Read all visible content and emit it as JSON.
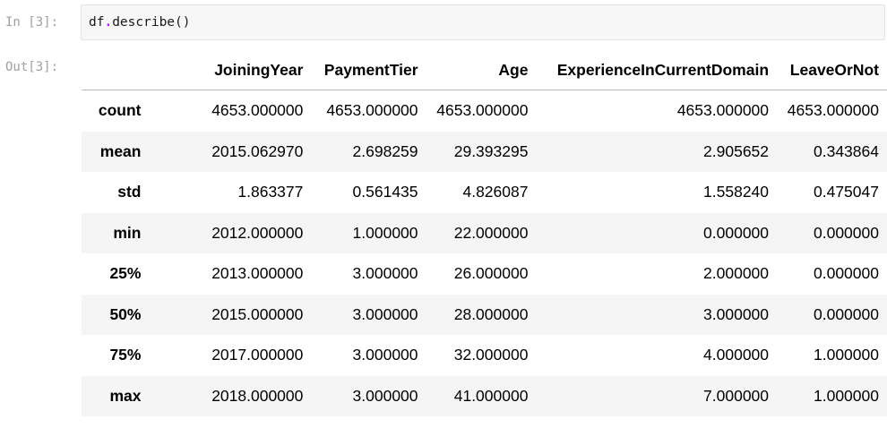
{
  "cell_in": {
    "prompt": "In [3]:",
    "code_obj": "df",
    "code_dot": ".",
    "code_method": "describe",
    "code_parens": "()"
  },
  "cell_out": {
    "prompt": "Out[3]:"
  },
  "table": {
    "columns": [
      "JoiningYear",
      "PaymentTier",
      "Age",
      "ExperienceInCurrentDomain",
      "LeaveOrNot"
    ],
    "rows": [
      {
        "index": "count",
        "values": [
          "4653.000000",
          "4653.000000",
          "4653.000000",
          "4653.000000",
          "4653.000000"
        ]
      },
      {
        "index": "mean",
        "values": [
          "2015.062970",
          "2.698259",
          "29.393295",
          "2.905652",
          "0.343864"
        ]
      },
      {
        "index": "std",
        "values": [
          "1.863377",
          "0.561435",
          "4.826087",
          "1.558240",
          "0.475047"
        ]
      },
      {
        "index": "min",
        "values": [
          "2012.000000",
          "1.000000",
          "22.000000",
          "0.000000",
          "0.000000"
        ]
      },
      {
        "index": "25%",
        "values": [
          "2013.000000",
          "3.000000",
          "26.000000",
          "2.000000",
          "0.000000"
        ]
      },
      {
        "index": "50%",
        "values": [
          "2015.000000",
          "3.000000",
          "28.000000",
          "3.000000",
          "0.000000"
        ]
      },
      {
        "index": "75%",
        "values": [
          "2017.000000",
          "3.000000",
          "32.000000",
          "4.000000",
          "1.000000"
        ]
      },
      {
        "index": "max",
        "values": [
          "2018.000000",
          "3.000000",
          "41.000000",
          "7.000000",
          "1.000000"
        ]
      }
    ]
  }
}
